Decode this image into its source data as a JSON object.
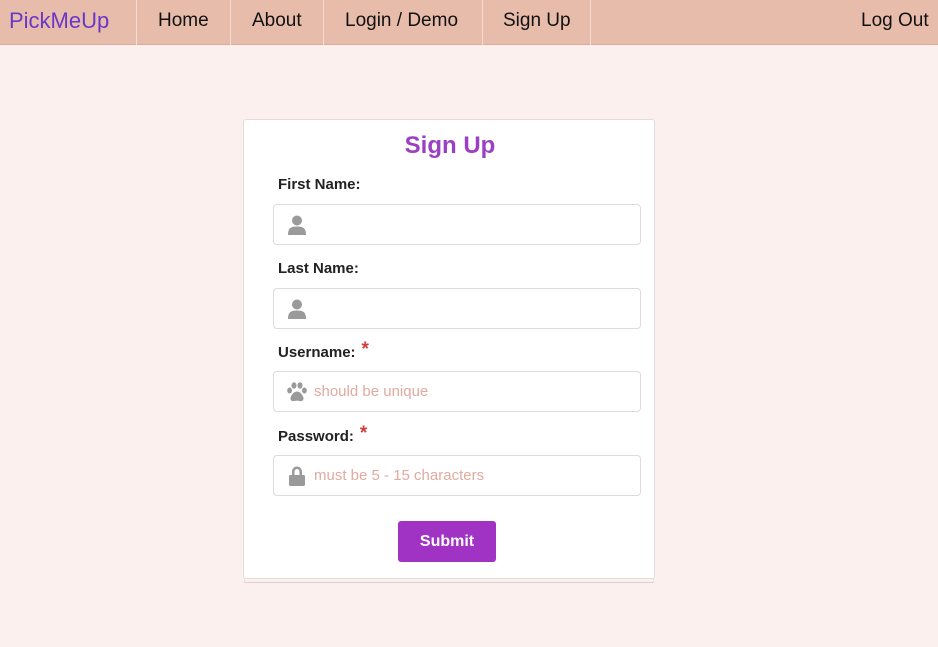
{
  "nav": {
    "brand": "PickMeUp",
    "items": [
      {
        "label": "Home"
      },
      {
        "label": "About"
      },
      {
        "label": "Login / Demo"
      },
      {
        "label": "Sign Up"
      }
    ],
    "logout": "Log Out"
  },
  "form": {
    "title": "Sign Up",
    "fields": [
      {
        "label": "First Name:",
        "required": false,
        "placeholder": "",
        "icon": "person-icon"
      },
      {
        "label": "Last Name:",
        "required": false,
        "placeholder": "",
        "icon": "person-icon"
      },
      {
        "label": "Username:",
        "required": true,
        "placeholder": "should be unique",
        "icon": "paw-icon"
      },
      {
        "label": "Password:",
        "required": true,
        "placeholder": "must be 5 - 15 characters",
        "icon": "lock-icon"
      }
    ],
    "required_mark": "*",
    "submit": "Submit"
  },
  "colors": {
    "navbar": "#e8bcaa",
    "background": "#fbf0ed",
    "brand": "#6a38c9",
    "accent": "#a033c4",
    "required": "#d23b3b",
    "placeholder": "#e1aa9f"
  }
}
